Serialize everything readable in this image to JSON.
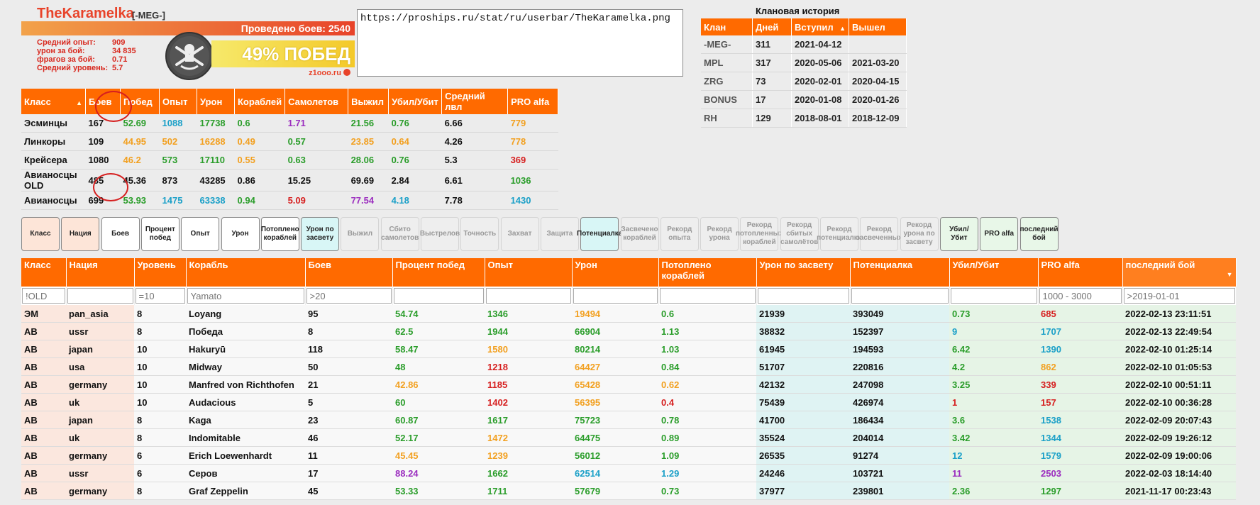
{
  "userbar": {
    "name": "TheKaramelka",
    "clan_tag": "[-MEG-]",
    "battles_text": "Проведено боев: 2540",
    "stats": [
      {
        "label": "Средний опыт:",
        "value": "909"
      },
      {
        "label": "урон за бой:",
        "value": "34 835"
      },
      {
        "label": "фрагов за бой:",
        "value": "0.71"
      },
      {
        "label": "Средний уровень:",
        "value": "5.7"
      }
    ],
    "win_text": "49% ПОБЕД",
    "site": "z1ooo.ru"
  },
  "url_box": {
    "value": "https://proships.ru/stat/ru/userbar/TheKaramelka.png"
  },
  "clan_history": {
    "title": "Клановая история",
    "headers": [
      "Клан",
      "Дней",
      "Вступил",
      "Вышел"
    ],
    "rows": [
      [
        "-MEG-",
        "311",
        "2021-04-12",
        ""
      ],
      [
        "MPL",
        "317",
        "2020-05-06",
        "2021-03-20"
      ],
      [
        "ZRG",
        "73",
        "2020-02-01",
        "2020-04-15"
      ],
      [
        "BONUS",
        "17",
        "2020-01-08",
        "2020-01-26"
      ],
      [
        "RH",
        "129",
        "2018-08-01",
        "2018-12-09"
      ]
    ]
  },
  "class_table": {
    "headers": [
      "Класс",
      "Боев",
      "Побед",
      "Опыт",
      "Урон",
      "Кораблей",
      "Самолетов",
      "Выжил",
      "Убил/Убит",
      "Средний лвл",
      "PRO alfa"
    ],
    "rows": [
      {
        "cells": [
          "Эсминцы",
          "167",
          "52.69",
          "1088",
          "17738",
          "0.6",
          "1.71",
          "21.56",
          "0.76",
          "6.66",
          "779"
        ],
        "colors": [
          "black",
          "black",
          "green",
          "blue",
          "green",
          "green",
          "purple",
          "green",
          "green",
          "black",
          "orange"
        ]
      },
      {
        "cells": [
          "Линкоры",
          "109",
          "44.95",
          "502",
          "16288",
          "0.49",
          "0.57",
          "23.85",
          "0.64",
          "4.26",
          "778"
        ],
        "colors": [
          "black",
          "black",
          "orange",
          "orange",
          "orange",
          "orange",
          "green",
          "orange",
          "orange",
          "black",
          "orange"
        ]
      },
      {
        "cells": [
          "Крейсера",
          "1080",
          "46.2",
          "573",
          "17110",
          "0.55",
          "0.63",
          "28.06",
          "0.76",
          "5.3",
          "369"
        ],
        "colors": [
          "black",
          "black",
          "orange",
          "green",
          "green",
          "orange",
          "green",
          "green",
          "green",
          "black",
          "red"
        ]
      },
      {
        "cells": [
          "Авианосцы OLD",
          "485",
          "45.36",
          "873",
          "43285",
          "0.86",
          "15.25",
          "69.69",
          "2.84",
          "6.61",
          "1036"
        ],
        "colors": [
          "black",
          "black",
          "black",
          "black",
          "black",
          "black",
          "black",
          "black",
          "black",
          "black",
          "green"
        ]
      },
      {
        "cells": [
          "Авианосцы",
          "699",
          "53.93",
          "1475",
          "63338",
          "0.94",
          "5.09",
          "77.54",
          "4.18",
          "7.78",
          "1430"
        ],
        "colors": [
          "black",
          "black",
          "green",
          "blue",
          "blue",
          "green",
          "red",
          "purple",
          "blue",
          "black",
          "blue"
        ]
      }
    ]
  },
  "toggle_buttons": [
    {
      "label": "Класс",
      "state": "peach"
    },
    {
      "label": "Нация",
      "state": "peach"
    },
    {
      "label": "Боев",
      "state": "white"
    },
    {
      "label": "Процент побед",
      "state": "white"
    },
    {
      "label": "Опыт",
      "state": "white"
    },
    {
      "label": "Урон",
      "state": "white"
    },
    {
      "label": "Потоплено кораблей",
      "state": "white"
    },
    {
      "label": "Урон по засвету",
      "state": "cyan"
    },
    {
      "label": "Выжил",
      "state": "off"
    },
    {
      "label": "Сбито самолетов",
      "state": "off"
    },
    {
      "label": "Выстрелов",
      "state": "off"
    },
    {
      "label": "Точность",
      "state": "off"
    },
    {
      "label": "Захват",
      "state": "off"
    },
    {
      "label": "Защита",
      "state": "off"
    },
    {
      "label": "Потенциалка",
      "state": "cyan"
    },
    {
      "label": "Засвечено кораблей",
      "state": "off"
    },
    {
      "label": "Рекорд опыта",
      "state": "off"
    },
    {
      "label": "Рекорд урона",
      "state": "off"
    },
    {
      "label": "Рекорд потопленных кораблей",
      "state": "off"
    },
    {
      "label": "Рекорд сбитых самолётов",
      "state": "off"
    },
    {
      "label": "Рекорд потенциалки",
      "state": "off"
    },
    {
      "label": "Рекорд засвеченных",
      "state": "off"
    },
    {
      "label": "Рекорд урона по засвету",
      "state": "off"
    },
    {
      "label": "Убил/Убит",
      "state": "mint"
    },
    {
      "label": "PRO alfa",
      "state": "mint"
    },
    {
      "label": "последний бой",
      "state": "mint"
    }
  ],
  "main_table": {
    "headers": [
      "Класс",
      "Нация",
      "Уровень",
      "Корабль",
      "Боев",
      "Процент побед",
      "Опыт",
      "Урон",
      "Потоплено кораблей",
      "Урон по засвету",
      "Потенциалка",
      "Убил/Убит",
      "PRO alfa",
      "последний бой"
    ],
    "filters": [
      {
        "value": "",
        "placeholder": "!OLD"
      },
      {
        "value": "",
        "placeholder": ""
      },
      {
        "value": "",
        "placeholder": "=10"
      },
      {
        "value": "",
        "placeholder": "Yamato"
      },
      {
        "value": "",
        "placeholder": ">20"
      },
      {
        "value": "",
        "placeholder": ""
      },
      {
        "value": "",
        "placeholder": ""
      },
      {
        "value": "",
        "placeholder": ""
      },
      {
        "value": "",
        "placeholder": ""
      },
      {
        "value": "",
        "placeholder": ""
      },
      {
        "value": "",
        "placeholder": ""
      },
      {
        "value": "",
        "placeholder": ""
      },
      {
        "value": "",
        "placeholder": "1000 - 3000"
      },
      {
        "value": "",
        "placeholder": ">2019-01-01"
      }
    ],
    "rows": [
      {
        "cells": [
          "ЭМ",
          "pan_asia",
          "8",
          "Loyang",
          "95",
          "54.74",
          "1346",
          "19494",
          "0.6",
          "21939",
          "393049",
          "0.73",
          "685",
          "2022-02-13 23:11:51"
        ],
        "colors": [
          "black",
          "black",
          "black",
          "black",
          "black",
          "green",
          "green",
          "orange",
          "green",
          "black",
          "black",
          "green",
          "red",
          "black"
        ]
      },
      {
        "cells": [
          "АВ",
          "ussr",
          "8",
          "Победа",
          "8",
          "62.5",
          "1944",
          "66904",
          "1.13",
          "38832",
          "152397",
          "9",
          "1707",
          "2022-02-13 22:49:54"
        ],
        "colors": [
          "black",
          "black",
          "black",
          "black",
          "black",
          "green",
          "green",
          "green",
          "green",
          "black",
          "black",
          "blue",
          "blue",
          "black"
        ]
      },
      {
        "cells": [
          "АВ",
          "japan",
          "10",
          "Hakuryū",
          "118",
          "58.47",
          "1580",
          "80214",
          "1.03",
          "61945",
          "194593",
          "6.42",
          "1390",
          "2022-02-10 01:25:14"
        ],
        "colors": [
          "black",
          "black",
          "black",
          "black",
          "black",
          "green",
          "orange",
          "green",
          "green",
          "black",
          "black",
          "green",
          "blue",
          "black"
        ]
      },
      {
        "cells": [
          "АВ",
          "usa",
          "10",
          "Midway",
          "50",
          "48",
          "1218",
          "64427",
          "0.84",
          "51707",
          "220816",
          "4.2",
          "862",
          "2022-02-10 01:05:53"
        ],
        "colors": [
          "black",
          "black",
          "black",
          "black",
          "black",
          "green",
          "red",
          "orange",
          "green",
          "black",
          "black",
          "green",
          "orange",
          "black"
        ]
      },
      {
        "cells": [
          "АВ",
          "germany",
          "10",
          "Manfred von Richthofen",
          "21",
          "42.86",
          "1185",
          "65428",
          "0.62",
          "42132",
          "247098",
          "3.25",
          "339",
          "2022-02-10 00:51:11"
        ],
        "colors": [
          "black",
          "black",
          "black",
          "black",
          "black",
          "orange",
          "red",
          "orange",
          "orange",
          "black",
          "black",
          "green",
          "red",
          "black"
        ]
      },
      {
        "cells": [
          "АВ",
          "uk",
          "10",
          "Audacious",
          "5",
          "60",
          "1402",
          "56395",
          "0.4",
          "75439",
          "426974",
          "1",
          "157",
          "2022-02-10 00:36:28"
        ],
        "colors": [
          "black",
          "black",
          "black",
          "black",
          "black",
          "green",
          "red",
          "orange",
          "red",
          "black",
          "black",
          "red",
          "red",
          "black"
        ]
      },
      {
        "cells": [
          "АВ",
          "japan",
          "8",
          "Kaga",
          "23",
          "60.87",
          "1617",
          "75723",
          "0.78",
          "41700",
          "186434",
          "3.6",
          "1538",
          "2022-02-09 20:07:43"
        ],
        "colors": [
          "black",
          "black",
          "black",
          "black",
          "black",
          "green",
          "green",
          "green",
          "green",
          "black",
          "black",
          "green",
          "blue",
          "black"
        ]
      },
      {
        "cells": [
          "АВ",
          "uk",
          "8",
          "Indomitable",
          "46",
          "52.17",
          "1472",
          "64475",
          "0.89",
          "35524",
          "204014",
          "3.42",
          "1344",
          "2022-02-09 19:26:12"
        ],
        "colors": [
          "black",
          "black",
          "black",
          "black",
          "black",
          "green",
          "orange",
          "green",
          "green",
          "black",
          "black",
          "green",
          "blue",
          "black"
        ]
      },
      {
        "cells": [
          "АВ",
          "germany",
          "6",
          "Erich Loewenhardt",
          "11",
          "45.45",
          "1239",
          "56012",
          "1.09",
          "26535",
          "91274",
          "12",
          "1579",
          "2022-02-09 19:00:06"
        ],
        "colors": [
          "black",
          "black",
          "black",
          "black",
          "black",
          "orange",
          "orange",
          "green",
          "green",
          "black",
          "black",
          "blue",
          "blue",
          "black"
        ]
      },
      {
        "cells": [
          "АВ",
          "ussr",
          "6",
          "Серов",
          "17",
          "88.24",
          "1662",
          "62514",
          "1.29",
          "24246",
          "103721",
          "11",
          "2503",
          "2022-02-03 18:14:40"
        ],
        "colors": [
          "black",
          "black",
          "black",
          "black",
          "black",
          "purple",
          "green",
          "blue",
          "blue",
          "black",
          "black",
          "purple",
          "purple",
          "black"
        ]
      },
      {
        "cells": [
          "АВ",
          "germany",
          "8",
          "Graf Zeppelin",
          "45",
          "53.33",
          "1711",
          "57679",
          "0.73",
          "37977",
          "239801",
          "2.36",
          "1297",
          "2021-11-17 00:23:43"
        ],
        "colors": [
          "black",
          "black",
          "black",
          "black",
          "black",
          "green",
          "green",
          "green",
          "green",
          "black",
          "black",
          "green",
          "green",
          "black"
        ]
      }
    ]
  }
}
